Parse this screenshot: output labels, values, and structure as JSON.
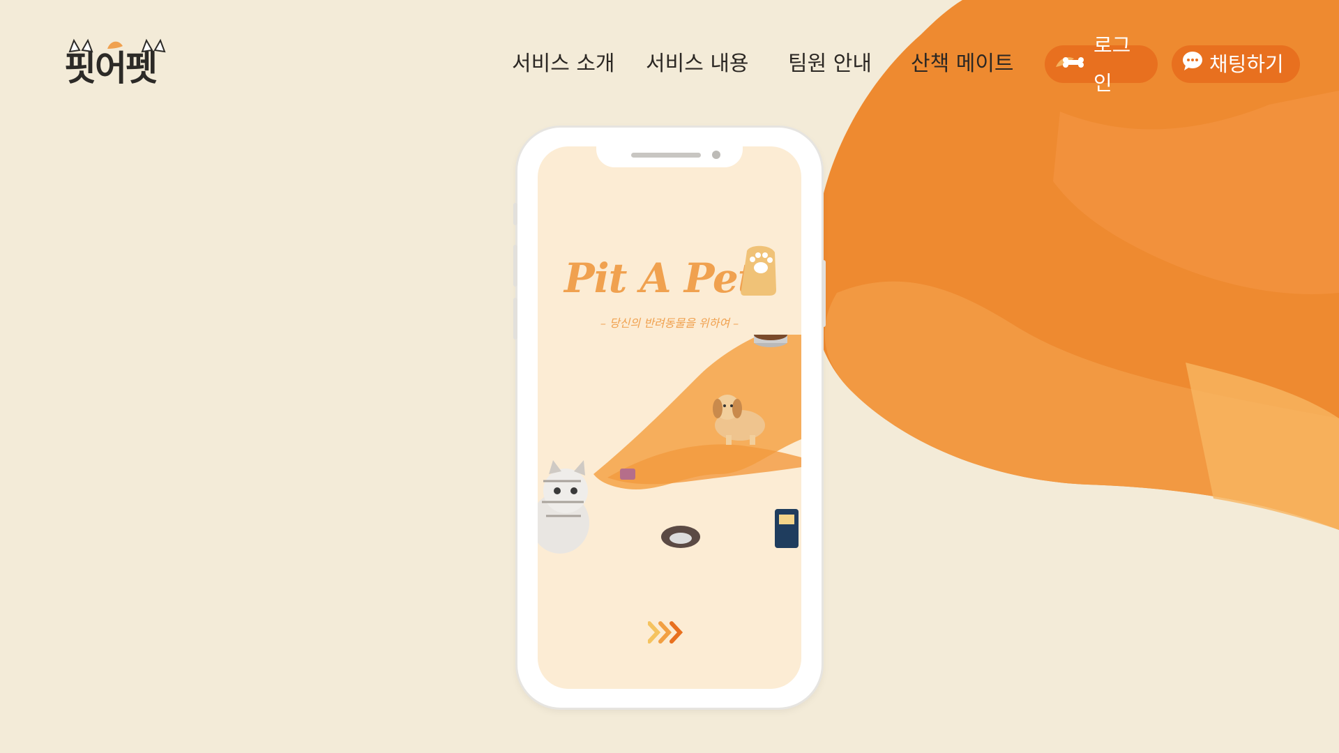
{
  "brand": {
    "logo_text": "핏어펫"
  },
  "nav": {
    "items": [
      {
        "label": "서비스 소개"
      },
      {
        "label": "서비스 내용"
      },
      {
        "label": "팀원 안내"
      },
      {
        "label": "산책 메이트"
      }
    ],
    "login_label": "로그인",
    "login_icon": "bone-icon",
    "chat_label": "채팅하기",
    "chat_icon": "chat-bubble-icon"
  },
  "phone": {
    "app_title": "Pit A Pet",
    "app_subtitle": "– 당신의 반려동물을 위하여 –",
    "next_icon": "triple-chevron-right-icon"
  },
  "colors": {
    "background": "#f3ebd8",
    "accent": "#e8701f",
    "accent_light": "#f5a653",
    "screen_bg": "#fcecd4",
    "text_dark": "#2b2723"
  }
}
